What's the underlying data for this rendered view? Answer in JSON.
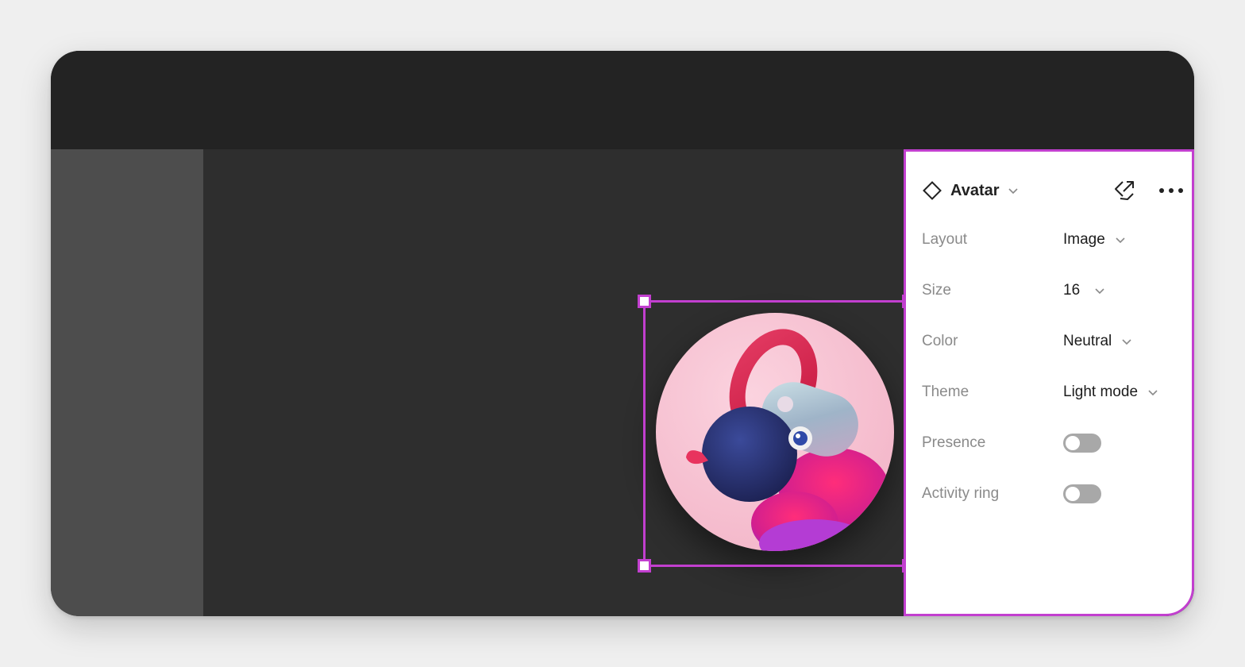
{
  "panel": {
    "component_name": "Avatar",
    "component_icon": "diamond-component-icon",
    "actions": {
      "goto_main_icon": "go-to-main-component-icon",
      "more_icon": "more-options-icon"
    },
    "properties": [
      {
        "label": "Layout",
        "type": "dropdown",
        "value": "Image"
      },
      {
        "label": "Size",
        "type": "dropdown",
        "value": "16"
      },
      {
        "label": "Color",
        "type": "dropdown",
        "value": "Neutral"
      },
      {
        "label": "Theme",
        "type": "dropdown",
        "value": "Light mode"
      },
      {
        "label": "Presence",
        "type": "toggle",
        "value": false
      },
      {
        "label": "Activity ring",
        "type": "toggle",
        "value": false
      }
    ]
  },
  "colors": {
    "selection": "#c23fcf",
    "topbar": "#232323",
    "canvas": "#2e2e2e",
    "left_panel": "#4d4d4d",
    "panel_bg": "#ffffff"
  }
}
